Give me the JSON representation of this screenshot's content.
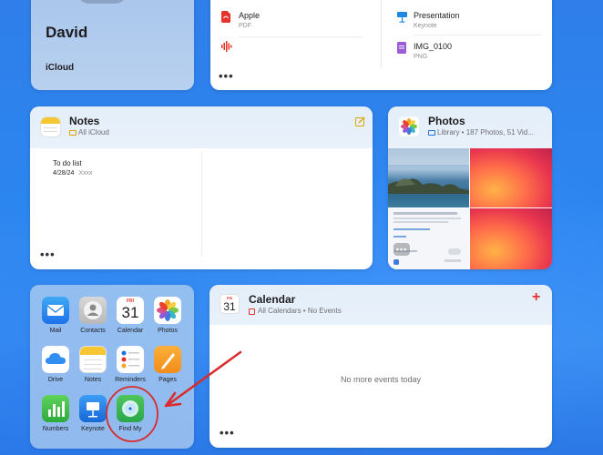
{
  "profile": {
    "name": "David",
    "subtitle": "iCloud"
  },
  "files": {
    "items": [
      {
        "name": "Apple",
        "type": "PDF",
        "icon": "pdf-icon"
      },
      {
        "name": "Presentation",
        "type": "Keynote",
        "icon": "keynote-icon"
      },
      {
        "name": "",
        "type": "",
        "icon": "audio-waveform-icon"
      },
      {
        "name": "IMG_0100",
        "type": "PNG",
        "icon": "image-file-icon"
      }
    ],
    "more": "•••"
  },
  "notes": {
    "title": "Notes",
    "folder": "All iCloud",
    "note_title": "To do list",
    "note_date": "4/28/24",
    "note_preview": "Xxxx",
    "more": "•••"
  },
  "photos": {
    "title": "Photos",
    "subtitle": "Library • 187 Photos, 51 Vid..."
  },
  "calendar": {
    "title": "Calendar",
    "subtitle": "All Calendars • No Events",
    "icon_month": "FRI",
    "icon_day": "31",
    "empty_message": "No more events today",
    "add": "+",
    "more": "•••"
  },
  "apps": [
    {
      "label": "Mail",
      "icon": "mail-icon"
    },
    {
      "label": "Contacts",
      "icon": "contacts-icon"
    },
    {
      "label": "Calendar",
      "icon": "calendar-icon",
      "day": "31",
      "month": "FRI"
    },
    {
      "label": "Photos",
      "icon": "photos-icon"
    },
    {
      "label": "Drive",
      "icon": "icloud-drive-icon"
    },
    {
      "label": "Notes",
      "icon": "notes-icon"
    },
    {
      "label": "Reminders",
      "icon": "reminders-icon"
    },
    {
      "label": "Pages",
      "icon": "pages-icon"
    },
    {
      "label": "Numbers",
      "icon": "numbers-icon"
    },
    {
      "label": "Keynote",
      "icon": "keynote-icon"
    },
    {
      "label": "Find My",
      "icon": "find-my-icon"
    }
  ],
  "colors": {
    "accent_red": "#e5332a",
    "annotation_red": "#d92b2b",
    "notes_yellow": "#f5c400",
    "link_blue": "#1d6fe0"
  }
}
